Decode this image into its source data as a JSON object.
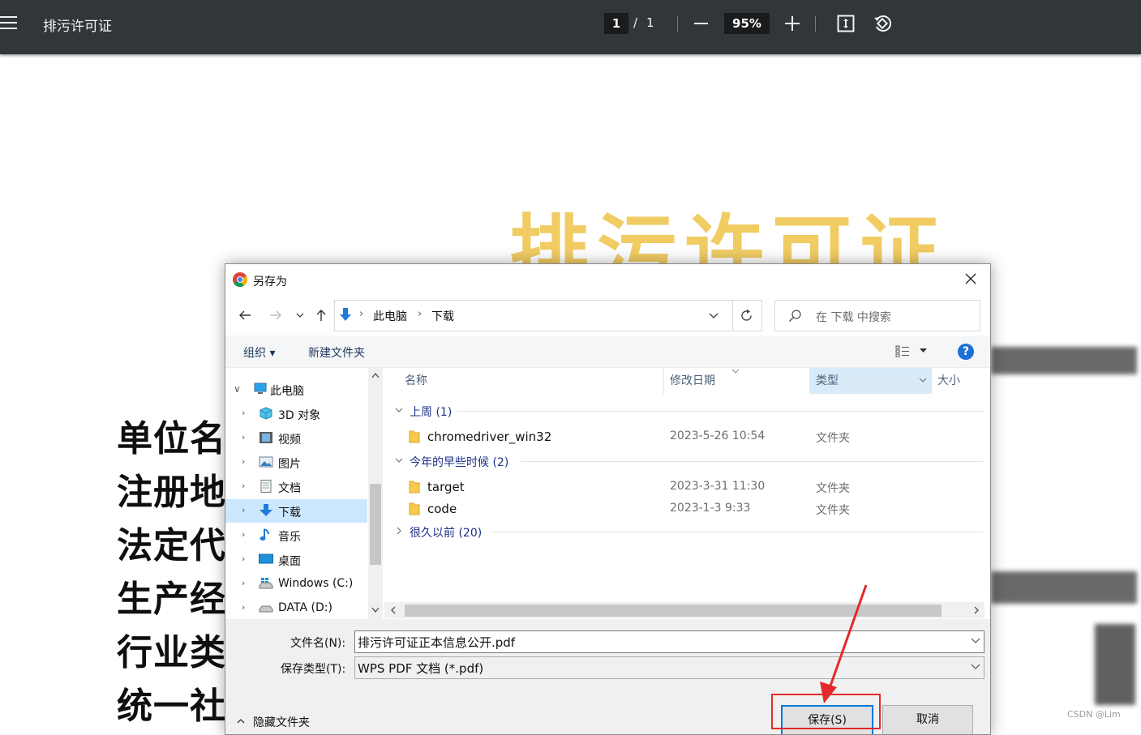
{
  "viewer": {
    "title": "排污许可证",
    "page_current": "1",
    "page_sep": "/",
    "page_total": "1",
    "zoom": "95%"
  },
  "pdf": {
    "heading": "排污许可证",
    "labels": [
      "单位名",
      "注册地",
      "法定代",
      "生产经",
      "行业类",
      "统一社"
    ],
    "watermark": "CSDN @Lim"
  },
  "dialog": {
    "title": "另存为",
    "breadcrumb": [
      "此电脑",
      "下载"
    ],
    "search_placeholder": "在 下载 中搜索",
    "organize": "组织 ▾",
    "new_folder": "新建文件夹",
    "help": "?",
    "tree": [
      {
        "label": "此电脑",
        "icon": "computer-icon"
      },
      {
        "label": "3D 对象",
        "icon": "3d-objects-icon"
      },
      {
        "label": "视频",
        "icon": "video-icon"
      },
      {
        "label": "图片",
        "icon": "pictures-icon"
      },
      {
        "label": "文档",
        "icon": "documents-icon"
      },
      {
        "label": "下载",
        "icon": "download-icon",
        "selected": true
      },
      {
        "label": "音乐",
        "icon": "music-icon"
      },
      {
        "label": "桌面",
        "icon": "desktop-icon"
      },
      {
        "label": "Windows (C:)",
        "icon": "drive-icon"
      },
      {
        "label": "DATA (D:)",
        "icon": "drive-icon"
      }
    ],
    "columns": {
      "name": "名称",
      "modified": "修改日期",
      "type": "类型",
      "size": "大小"
    },
    "groups": [
      {
        "label": "上周 (1)",
        "expanded": true,
        "files": [
          {
            "name": "chromedriver_win32",
            "modified": "2023-5-26 10:54",
            "type": "文件夹"
          }
        ]
      },
      {
        "label": "今年的早些时候 (2)",
        "expanded": true,
        "files": [
          {
            "name": "target",
            "modified": "2023-3-31 11:30",
            "type": "文件夹"
          },
          {
            "name": "code",
            "modified": "2023-1-3 9:33",
            "type": "文件夹"
          }
        ]
      },
      {
        "label": "很久以前 (20)",
        "expanded": false,
        "files": []
      }
    ],
    "filename_label": "文件名(N):",
    "filename_value": "排污许可证正本信息公开.pdf",
    "filetype_label": "保存类型(T):",
    "filetype_value": "WPS PDF 文档 (*.pdf)",
    "hide_folders": "隐藏文件夹",
    "save": "保存(S)",
    "cancel": "取消"
  },
  "colors": {
    "toolbar_bg": "#323639",
    "pdf_heading": "#f0cc63",
    "highlight": "#e22a2a",
    "accent": "#0078d7"
  }
}
